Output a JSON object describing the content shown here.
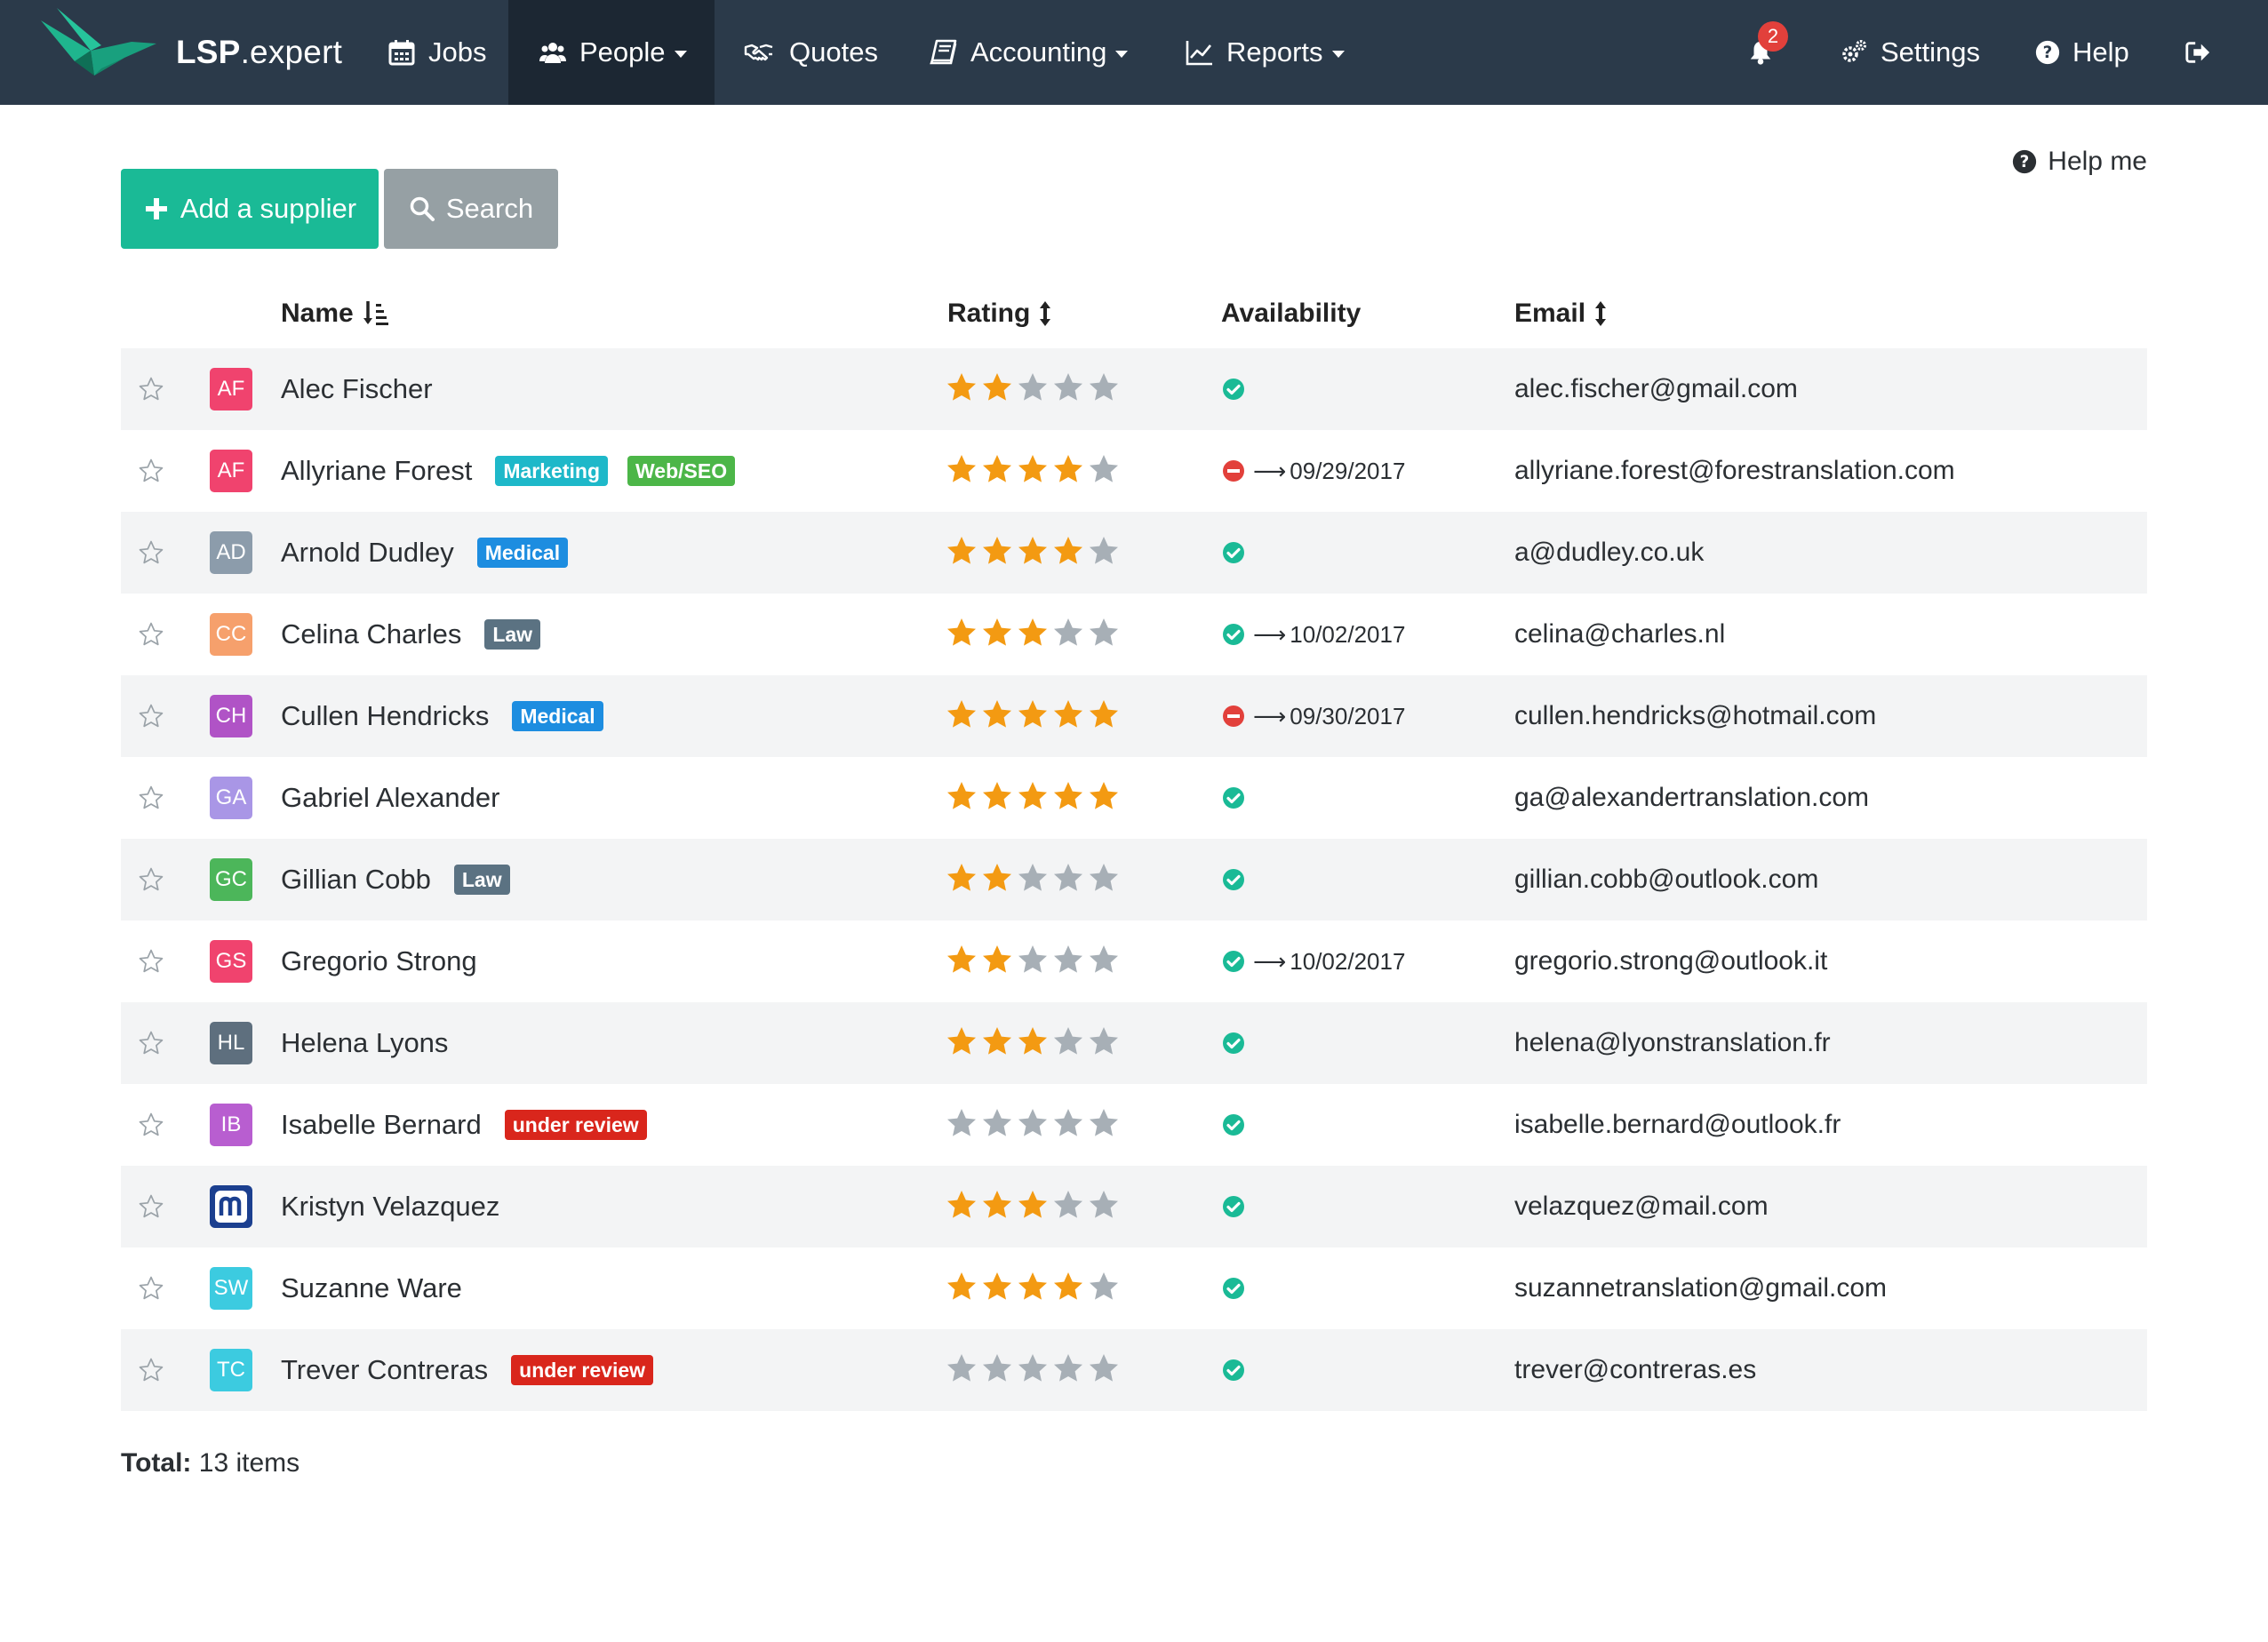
{
  "brand": {
    "name_bold": "LSP",
    "name_rest": ".expert"
  },
  "nav": {
    "jobs": "Jobs",
    "people": "People",
    "quotes": "Quotes",
    "accounting": "Accounting",
    "reports": "Reports",
    "notification_count": "2",
    "settings": "Settings",
    "help": "Help"
  },
  "toolbar": {
    "add_label": "Add a supplier",
    "search_label": "Search",
    "help_me": "Help me"
  },
  "table": {
    "columns": {
      "name": "Name",
      "rating": "Rating",
      "availability": "Availability",
      "email": "Email"
    },
    "rows": [
      {
        "initials": "AF",
        "avatar_color": "#f0436e",
        "name": "Alec Fischer",
        "tags": [],
        "rating": 2,
        "status": "available",
        "date": "",
        "email": "alec.fischer@gmail.com"
      },
      {
        "initials": "AF",
        "avatar_color": "#f0436e",
        "name": "Allyriane Forest",
        "tags": [
          {
            "label": "Marketing",
            "color": "#1eb8c9"
          },
          {
            "label": "Web/SEO",
            "color": "#4cb648"
          }
        ],
        "rating": 4,
        "status": "unavailable",
        "date": "09/29/2017",
        "email": "allyriane.forest@forestranslation.com"
      },
      {
        "initials": "AD",
        "avatar_color": "#8c9cab",
        "name": "Arnold Dudley",
        "tags": [
          {
            "label": "Medical",
            "color": "#1d8de0"
          }
        ],
        "rating": 4,
        "status": "available",
        "date": "",
        "email": "a@dudley.co.uk"
      },
      {
        "initials": "CC",
        "avatar_color": "#f6a06c",
        "name": "Celina Charles",
        "tags": [
          {
            "label": "Law",
            "color": "#5b7282"
          }
        ],
        "rating": 3,
        "status": "available",
        "date": "10/02/2017",
        "email": "celina@charles.nl"
      },
      {
        "initials": "CH",
        "avatar_color": "#b053c6",
        "name": "Cullen Hendricks",
        "tags": [
          {
            "label": "Medical",
            "color": "#1d8de0"
          }
        ],
        "rating": 5,
        "status": "unavailable",
        "date": "09/30/2017",
        "email": "cullen.hendricks@hotmail.com"
      },
      {
        "initials": "GA",
        "avatar_color": "#a996e6",
        "name": "Gabriel Alexander",
        "tags": [],
        "rating": 5,
        "status": "available",
        "date": "",
        "email": "ga@alexandertranslation.com"
      },
      {
        "initials": "GC",
        "avatar_color": "#4cb65a",
        "name": "Gillian Cobb",
        "tags": [
          {
            "label": "Law",
            "color": "#5b7282"
          }
        ],
        "rating": 2,
        "status": "available",
        "date": "",
        "email": "gillian.cobb@outlook.com"
      },
      {
        "initials": "GS",
        "avatar_color": "#f0436e",
        "name": "Gregorio Strong",
        "tags": [],
        "rating": 2,
        "status": "available",
        "date": "10/02/2017",
        "email": "gregorio.strong@outlook.it"
      },
      {
        "initials": "HL",
        "avatar_color": "#5e6f7e",
        "name": "Helena Lyons",
        "tags": [],
        "rating": 3,
        "status": "available",
        "date": "",
        "email": "helena@lyonstranslation.fr"
      },
      {
        "initials": "IB",
        "avatar_color": "#b85ed0",
        "name": "Isabelle Bernard",
        "tags": [
          {
            "label": "under review",
            "color": "#d9261c"
          }
        ],
        "rating": 0,
        "status": "available",
        "date": "",
        "email": "isabelle.bernard@outlook.fr"
      },
      {
        "initials": "m",
        "avatar_color": "#1b3f8f",
        "avatar_icon": "mailbox-logo-icon",
        "name": "Kristyn Velazquez",
        "tags": [],
        "rating": 3,
        "status": "available",
        "date": "",
        "email": "velazquez@mail.com"
      },
      {
        "initials": "SW",
        "avatar_color": "#3ccbe0",
        "name": "Suzanne Ware",
        "tags": [],
        "rating": 4,
        "status": "available",
        "date": "",
        "email": "suzannetranslation@gmail.com"
      },
      {
        "initials": "TC",
        "avatar_color": "#3ccbe0",
        "name": "Trever Contreras",
        "tags": [
          {
            "label": "under review",
            "color": "#d9261c"
          }
        ],
        "rating": 0,
        "status": "available",
        "date": "",
        "email": "trever@contreras.es"
      }
    ]
  },
  "footer": {
    "total_label": "Total:",
    "total_value": "13 items"
  },
  "colors": {
    "navbar": "#2b3a4a",
    "navbar_active": "#1c2733",
    "add_button": "#1aba96",
    "search_button": "#96a0a4",
    "star_on": "#f39a12",
    "star_off": "#a7afb6",
    "available": "#1aba96",
    "unavailable": "#e2403b"
  }
}
